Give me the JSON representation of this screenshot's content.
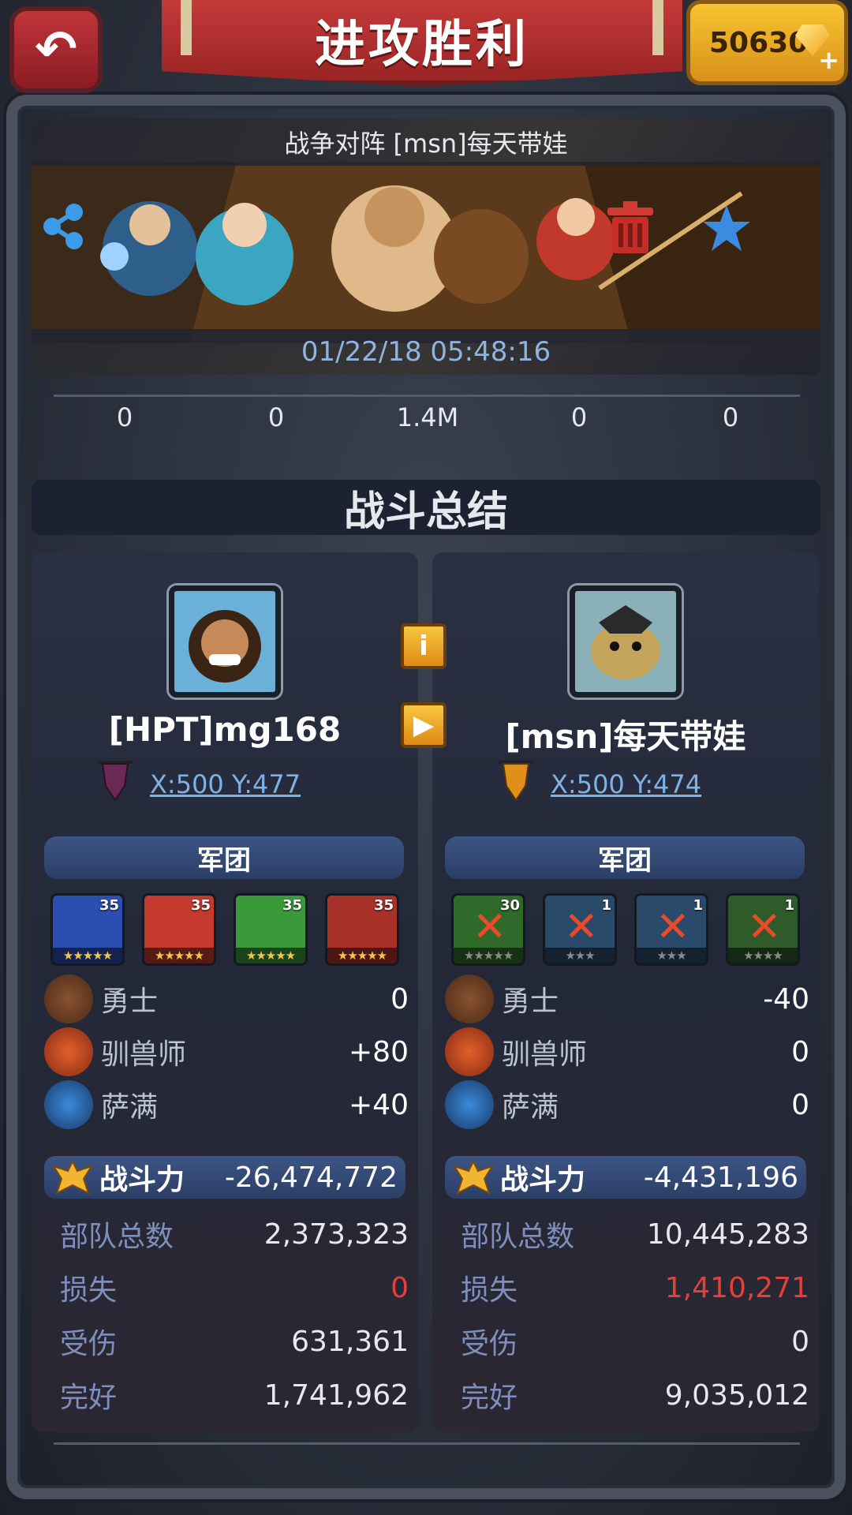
{
  "header": {
    "title": "进攻胜利",
    "gems": "50630",
    "gem_icon": "gem-icon",
    "back_icon": "back-arrow-icon"
  },
  "battle": {
    "subtitle": "战争对阵 [msn]每天带娃",
    "timestamp": "01/22/18 05:48:16",
    "stats": [
      "0",
      "0",
      "1.4M",
      "0",
      "0"
    ]
  },
  "summary": {
    "title": "战斗总结"
  },
  "left": {
    "name": "[HPT]mg168",
    "coords": "X:500 Y:477",
    "guild_color": "#6b2a55",
    "legion_label": "军团",
    "heroes": [
      {
        "level": "35",
        "stars": "★★★★★",
        "color": "#2b4fb0",
        "defeated": false
      },
      {
        "level": "35",
        "stars": "★★★★★",
        "color": "#c43a2e",
        "defeated": false
      },
      {
        "level": "35",
        "stars": "★★★★★",
        "color": "#3a9a3a",
        "defeated": false
      },
      {
        "level": "35",
        "stars": "★★★★★",
        "color": "#a8322a",
        "defeated": false
      }
    ],
    "units": [
      {
        "label": "勇士",
        "value": "0"
      },
      {
        "label": "驯兽师",
        "value": "+80"
      },
      {
        "label": "萨满",
        "value": "+40"
      }
    ],
    "power_label": "战斗力",
    "power_value": "-26,474,772",
    "stats": [
      {
        "label": "部队总数",
        "value": "2,373,323"
      },
      {
        "label": "损失",
        "value": "0"
      },
      {
        "label": "受伤",
        "value": "631,361"
      },
      {
        "label": "完好",
        "value": "1,741,962"
      }
    ]
  },
  "right": {
    "name": "[msn]每天带娃",
    "coords": "X:500 Y:474",
    "guild_color": "#e0901a",
    "legion_label": "军团",
    "heroes": [
      {
        "level": "30",
        "stars": "★★★★★",
        "color": "#2f6a2a",
        "defeated": true
      },
      {
        "level": "1",
        "stars": "★★★",
        "color": "#2a4a6a",
        "defeated": true
      },
      {
        "level": "1",
        "stars": "★★★",
        "color": "#2a4a6a",
        "defeated": true
      },
      {
        "level": "1",
        "stars": "★★★★",
        "color": "#2f5a2a",
        "defeated": true
      }
    ],
    "units": [
      {
        "label": "勇士",
        "value": "-40"
      },
      {
        "label": "驯兽师",
        "value": "0"
      },
      {
        "label": "萨满",
        "value": "0"
      }
    ],
    "power_label": "战斗力",
    "power_value": "-4,431,196",
    "stats": [
      {
        "label": "部队总数",
        "value": "10,445,283"
      },
      {
        "label": "损失",
        "value": "1,410,271"
      },
      {
        "label": "受伤",
        "value": "0"
      },
      {
        "label": "完好",
        "value": "9,035,012"
      }
    ]
  },
  "buttons": {
    "info": "i",
    "play": "▶"
  }
}
